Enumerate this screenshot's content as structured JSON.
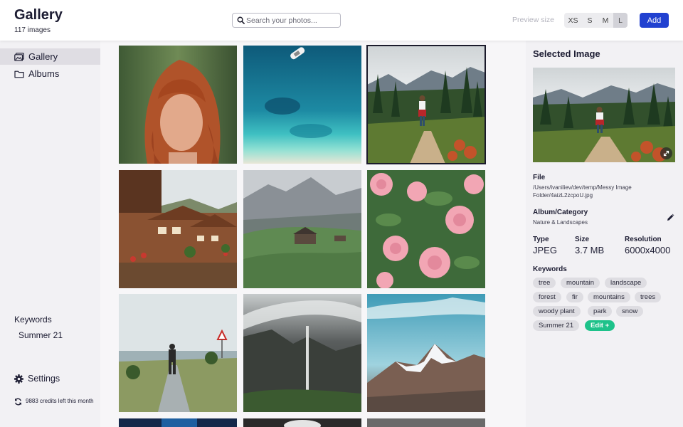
{
  "header": {
    "title": "Gallery",
    "subtitle": "117 images",
    "search_placeholder": "Search your photos...",
    "preview_size_label": "Preview size",
    "sizes": [
      "XS",
      "S",
      "M",
      "L"
    ],
    "selected_size": "L",
    "add_label": "Add",
    "accent_color": "#2141d0"
  },
  "sidebar": {
    "nav": [
      {
        "label": "Gallery",
        "icon": "gallery-icon",
        "active": true
      },
      {
        "label": "Albums",
        "icon": "folder-icon",
        "active": false
      }
    ],
    "keywords_heading": "Keywords",
    "keywords": [
      "Summer 21"
    ],
    "settings_label": "Settings",
    "credits_text": "9883 credits left this month"
  },
  "gallery": {
    "images": [
      {
        "subject": "red-haired woman portrait"
      },
      {
        "subject": "aerial sea with boat"
      },
      {
        "subject": "hiker in mountains",
        "selected": true
      },
      {
        "subject": "wooden chalets"
      },
      {
        "subject": "alpine meadow huts"
      },
      {
        "subject": "pink roses"
      },
      {
        "subject": "man walking on path"
      },
      {
        "subject": "misty waterfall cliffs"
      },
      {
        "subject": "snowy mountain peak"
      }
    ]
  },
  "panel": {
    "title": "Selected Image",
    "file_label": "File",
    "file_path": "/Users/ivaniliev/dev/temp/Messy Image Folder/4aizL2zcpoU.jpg",
    "album_label": "Album/Category",
    "album_value": "Nature & Landscapes",
    "type_label": "Type",
    "type_value": "JPEG",
    "size_label": "Size",
    "size_value": "3.7 MB",
    "resolution_label": "Resolution",
    "resolution_value": "6000x4000",
    "keywords_label": "Keywords",
    "keywords": [
      "tree",
      "mountain",
      "landscape",
      "forest",
      "fir",
      "mountains",
      "trees",
      "woody plant",
      "park",
      "snow",
      "Summer 21"
    ],
    "edit_label": "Edit +",
    "edit_color": "#1ec28a"
  }
}
